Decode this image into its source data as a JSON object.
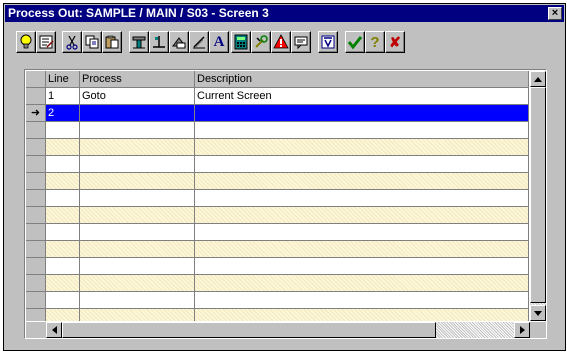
{
  "window": {
    "title": "Process Out: SAMPLE / MAIN / S03 - Screen 3",
    "close_label": "×"
  },
  "toolbar": {
    "buttons": [
      {
        "icon": "lightbulb-icon",
        "name": "tip-button"
      },
      {
        "icon": "properties-icon",
        "name": "properties-button"
      },
      {
        "icon": "scissors-icon",
        "name": "cut-button"
      },
      {
        "icon": "copy-icon",
        "name": "copy-button"
      },
      {
        "icon": "paste-icon",
        "name": "paste-button"
      },
      {
        "icon": "tool-icon",
        "name": "tool-button"
      },
      {
        "icon": "layout-icon",
        "name": "layout-button"
      },
      {
        "icon": "move-icon",
        "name": "move-button"
      },
      {
        "icon": "edit-icon",
        "name": "edit-button"
      },
      {
        "icon": "font-icon",
        "name": "font-button",
        "label": "A"
      },
      {
        "icon": "calculator-icon",
        "name": "calculator-button"
      },
      {
        "icon": "tools-icon",
        "name": "tools-button"
      },
      {
        "icon": "warning-icon",
        "name": "warning-button",
        "label": "!"
      },
      {
        "icon": "comment-icon",
        "name": "comment-button"
      },
      {
        "icon": "filter-icon",
        "name": "filter-button"
      },
      {
        "icon": "checkmark-icon",
        "name": "ok-button"
      },
      {
        "icon": "help-icon",
        "name": "help-button",
        "label": "?"
      },
      {
        "icon": "cancel-icon",
        "name": "cancel-button",
        "label": "✘"
      }
    ],
    "colors": {
      "ok": "#008000",
      "cancel": "#c00000",
      "warning": "#ff0000",
      "tip": "#ffff00"
    }
  },
  "grid": {
    "columns": [
      "Line",
      "Process",
      "Description"
    ],
    "rows": [
      {
        "line": "1",
        "process": "Goto",
        "description": "Current Screen"
      },
      {
        "line": "2",
        "process": "",
        "description": ""
      }
    ],
    "empty_row_count": 12,
    "selected_row_index": 1,
    "current_row_marker": "➜",
    "colors": {
      "selected": "#0000ff",
      "alt_row": "#fdf7d8"
    }
  }
}
